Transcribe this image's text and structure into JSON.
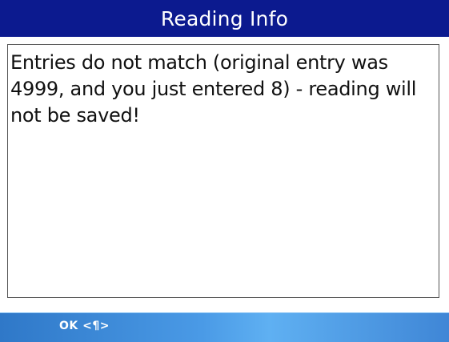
{
  "window": {
    "title": "Reading Info"
  },
  "dialog": {
    "message": "Entries do not match (original entry was 4999, and you just entered 8) -  reading will not be saved!"
  },
  "softkeys": {
    "left_label": "OK <¶>"
  }
}
